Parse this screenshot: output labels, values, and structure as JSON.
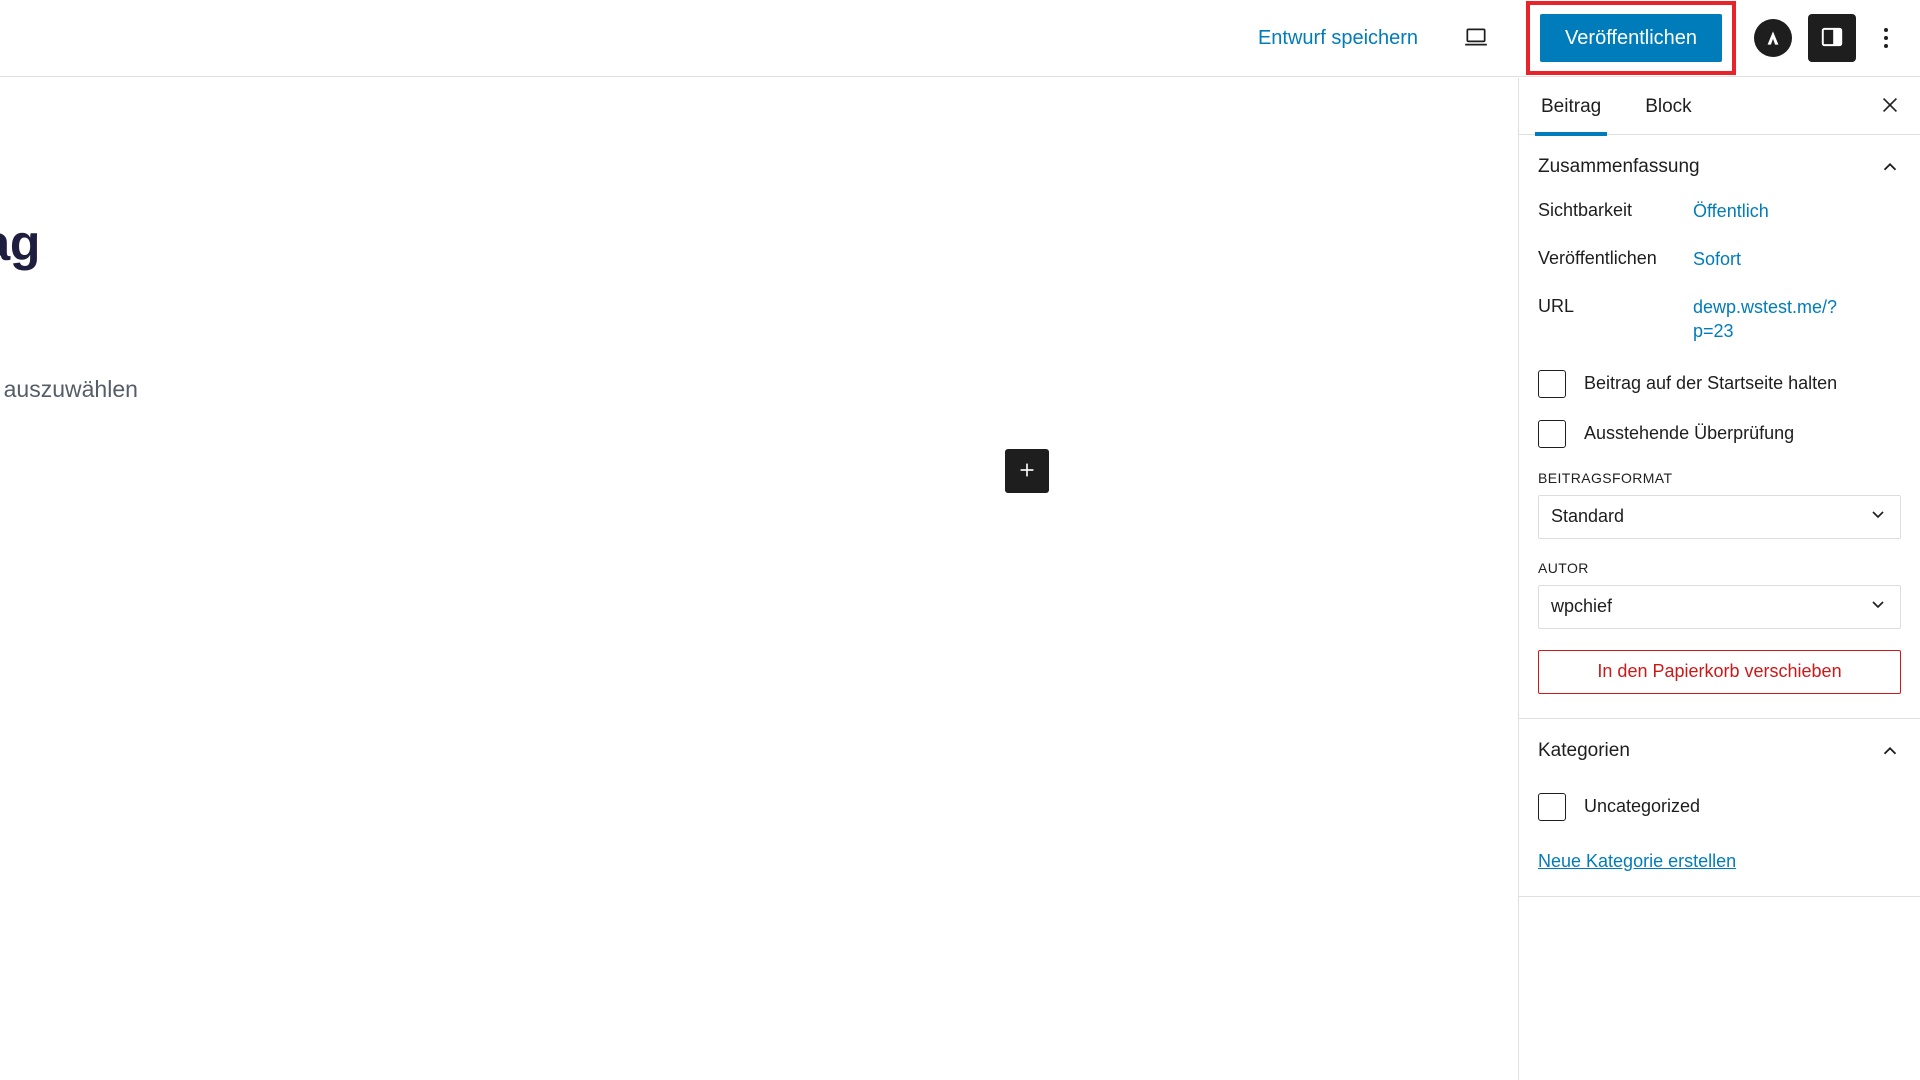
{
  "header": {
    "save_draft_label": "Entwurf speichern",
    "preview_icon": "laptop-preview-icon",
    "publish_label": "Veröffentlichen",
    "astra_logo_icon": "astra-logo-icon",
    "settings_toggle_icon": "sidebar-panel-icon",
    "more_menu_icon": "more-vertical-icon",
    "highlight_color": "#e8242a",
    "accent_color": "#007cba"
  },
  "editor": {
    "post_title": "t Beitrag",
    "block_placeholder": "um einen Block auszuwählen",
    "appender_icon": "plus-icon"
  },
  "sidebar": {
    "tabs": [
      {
        "label": "Beitrag",
        "active": true
      },
      {
        "label": "Block",
        "active": false
      }
    ],
    "close_icon": "close-icon",
    "summary": {
      "title": "Zusammenfassung",
      "collapse_icon": "chevron-up-icon",
      "rows": [
        {
          "label": "Sichtbarkeit",
          "value": "Öffentlich"
        },
        {
          "label": "Veröffentlichen",
          "value": "Sofort"
        },
        {
          "label": "URL",
          "value": "dewp.wstest.me/?p=23"
        }
      ],
      "checkboxes": [
        {
          "label": "Beitrag auf der Startseite halten",
          "checked": false
        },
        {
          "label": "Ausstehende Überprüfung",
          "checked": false
        }
      ],
      "post_format": {
        "label": "BEITRAGSFORMAT",
        "value": "Standard",
        "chevron_icon": "chevron-down-icon"
      },
      "author": {
        "label": "AUTOR",
        "value": "wpchief",
        "chevron_icon": "chevron-down-icon"
      },
      "trash_label": "In den Papierkorb verschieben",
      "trash_color": "#cc1818"
    },
    "categories": {
      "title": "Kategorien",
      "collapse_icon": "chevron-up-icon",
      "items": [
        {
          "label": "Uncategorized",
          "checked": false
        }
      ],
      "add_new_label": "Neue Kategorie erstellen"
    }
  }
}
